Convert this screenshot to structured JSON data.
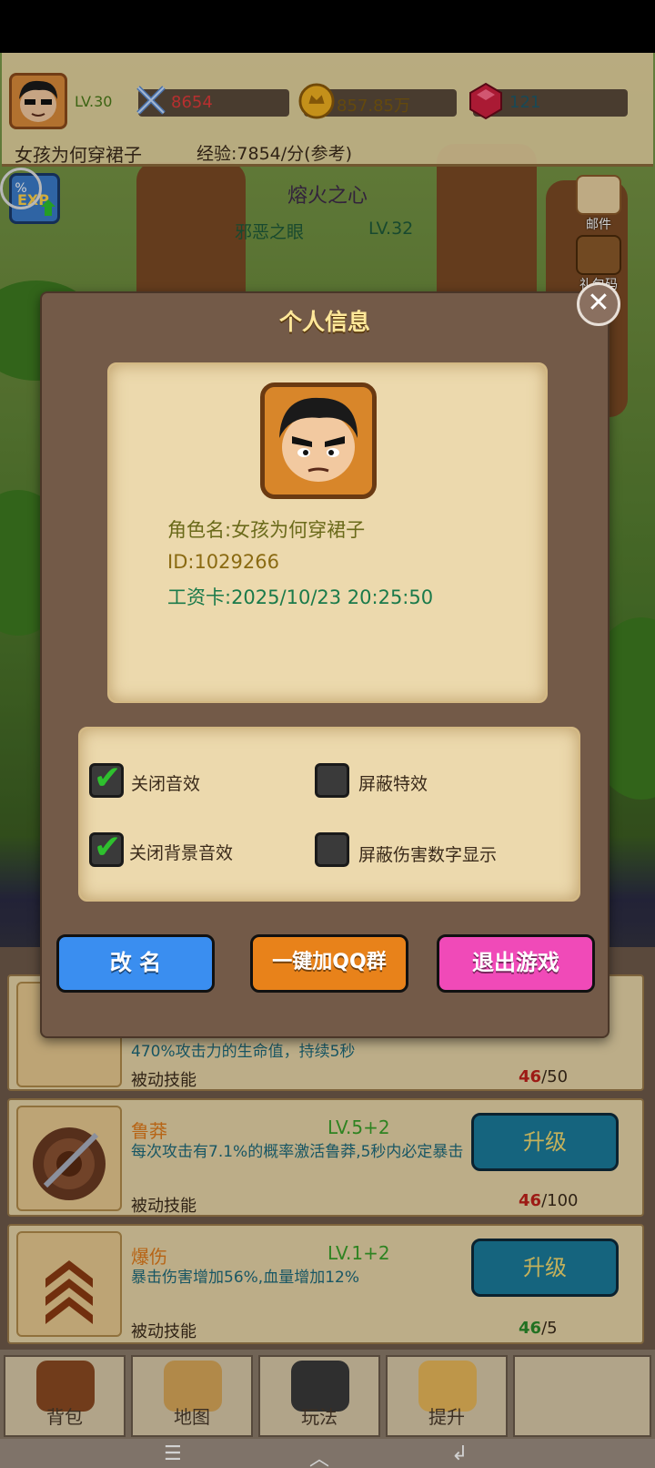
{
  "header": {
    "level": "LV.30",
    "power": "8654",
    "gold": "857.85万",
    "gems": "121",
    "player_name": "女孩为何穿裙子",
    "exp_rate": "经验:7854/分(参考)",
    "exp_percent": "%"
  },
  "boss": {
    "title": "熔火之心",
    "enemy": "邪恶之眼",
    "enemy_level": "LV.32"
  },
  "side_buttons": {
    "mail": "邮件",
    "gift_code": "礼包码",
    "other": "榜"
  },
  "dialog": {
    "title": "个人信息",
    "close_symbol": "✕",
    "character_name": "角色名:女孩为何穿裙子",
    "id": "ID:1029266",
    "pay_card": "工资卡:2025/10/23 20:25:50",
    "options": [
      {
        "label": "关闭音效",
        "checked": true
      },
      {
        "label": "屏蔽特效",
        "checked": false
      },
      {
        "label": "关闭背景音效",
        "checked": true
      },
      {
        "label": "屏蔽伤害数字显示",
        "checked": false
      }
    ],
    "check_mark": "✔",
    "buttons": {
      "rename": "改 名",
      "join_qq": "一键加QQ群",
      "exit": "退出游戏"
    }
  },
  "skills": [
    {
      "name": "",
      "level": "",
      "desc": "470%攻击力的生命值，持续5秒",
      "type": "被动技能",
      "cost_have": "46",
      "cost_need": "/50"
    },
    {
      "name": "鲁莽",
      "level": "LV.5+2",
      "desc": "每次攻击有7.1%的概率激活鲁莽,5秒内必定暴击",
      "type": "被动技能",
      "cost_have": "46",
      "cost_need": "/100",
      "button": "升级"
    },
    {
      "name": "爆伤",
      "level": "LV.1+2",
      "desc": "暴击伤害增加56%,血量增加12%",
      "type": "被动技能",
      "cost_have": "46",
      "cost_need": "/5",
      "button": "升级"
    }
  ],
  "bottom_nav": [
    "背包",
    "地图",
    "玩法",
    "提升"
  ],
  "system_nav": {
    "menu": "☰",
    "home": "︿",
    "back": "↲"
  },
  "colors": {
    "dialog_bg": "#735a48",
    "parchment": "#ecd9ad",
    "rename_btn": "#3a8ef0",
    "qq_btn": "#e8821a",
    "exit_btn": "#f04ab8",
    "upgrade_btn": "#1a7a9a"
  }
}
